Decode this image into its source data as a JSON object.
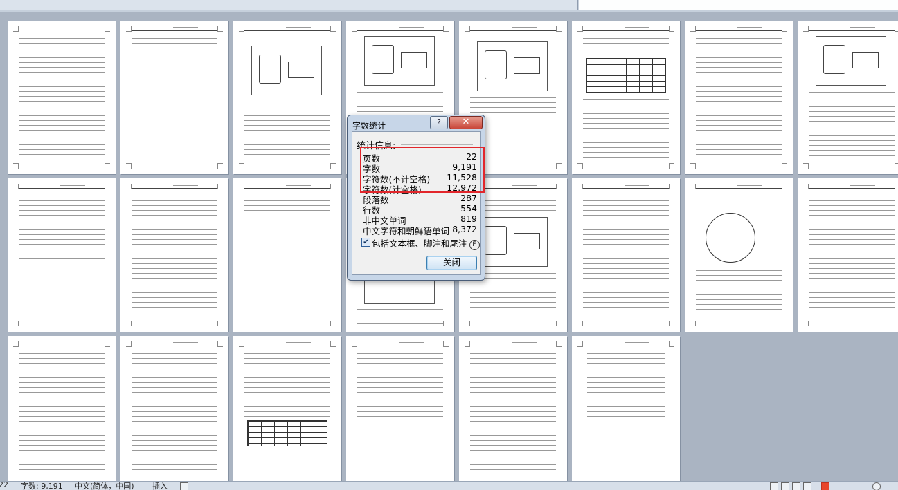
{
  "dialog": {
    "title": "字数统计",
    "help_glyph": "?",
    "close_glyph": "✕",
    "section_label": "统计信息:",
    "stats": [
      {
        "label": "页数",
        "value": "22"
      },
      {
        "label": "字数",
        "value": "9,191"
      },
      {
        "label": "字符数(不计空格)",
        "value": "11,528"
      },
      {
        "label": "字符数(计空格)",
        "value": "12,972"
      },
      {
        "label": "段落数",
        "value": "287"
      },
      {
        "label": "行数",
        "value": "554"
      },
      {
        "label": "非中文单词",
        "value": "819"
      },
      {
        "label": "中文字符和朝鲜语单词",
        "value": "8,372"
      }
    ],
    "checkbox_label": "包括文本框、脚注和尾注",
    "checkbox_accel": "F",
    "checkbox_checked": true,
    "checkbox_mark": "✔",
    "close_button": "关闭"
  },
  "status_bar": {
    "page": "22",
    "word_count": "字数: 9,191",
    "language": "中文(简体，中国)",
    "mode": "插入"
  },
  "colors": {
    "highlight": "#e2262b",
    "workspace": "#aab4c2"
  }
}
